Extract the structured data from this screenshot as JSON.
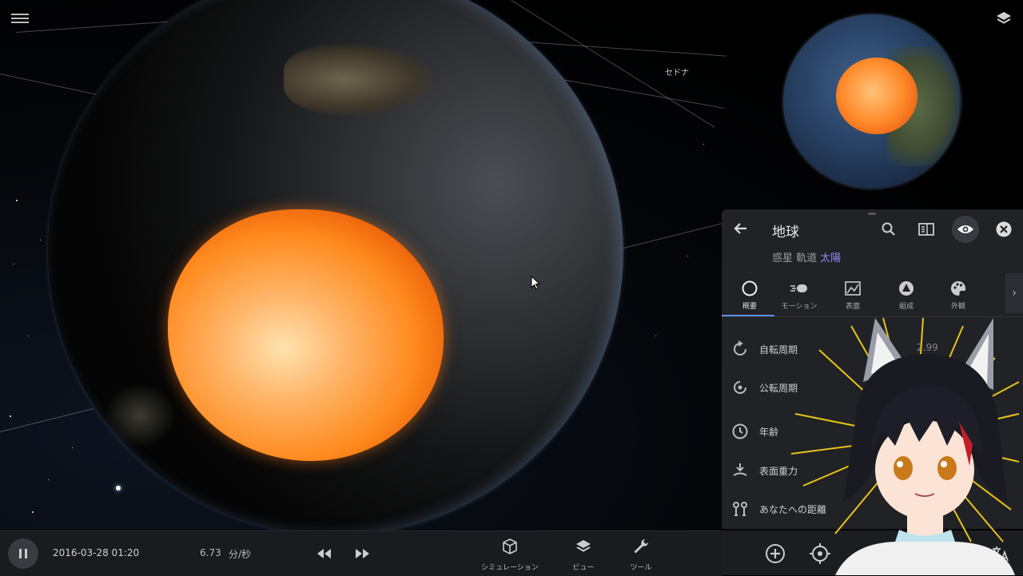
{
  "scene": {
    "label": "セドナ"
  },
  "panel": {
    "title": "地球",
    "subtitle_prefix": "惑星 軌道",
    "subtitle_link": "太陽",
    "tabs": [
      {
        "label": "概要"
      },
      {
        "label": "モーション"
      },
      {
        "label": "表面"
      },
      {
        "label": "組成"
      },
      {
        "label": "外観"
      }
    ],
    "properties": [
      {
        "label": "自転周期",
        "value": "2.99"
      },
      {
        "label": "公転周期",
        "value": ""
      },
      {
        "label": "年齢",
        "value": ""
      },
      {
        "label": "表面重力",
        "value": ""
      },
      {
        "label": "あなたへの距離",
        "value": ""
      }
    ]
  },
  "bottom_bar": {
    "date": "2016-03-28 01:20",
    "speed_value": "6.73",
    "speed_unit": "分/秒",
    "tools": [
      {
        "label": "シミュレーション",
        "icon": "cube-icon"
      },
      {
        "label": "ビュー",
        "icon": "layers-icon"
      },
      {
        "label": "ツール",
        "icon": "wrench-icon"
      }
    ]
  },
  "colors": {
    "accent": "#5b8de8",
    "link": "#8a8cf0",
    "panel_bg": "#212226",
    "core": "#ff8a1e"
  }
}
